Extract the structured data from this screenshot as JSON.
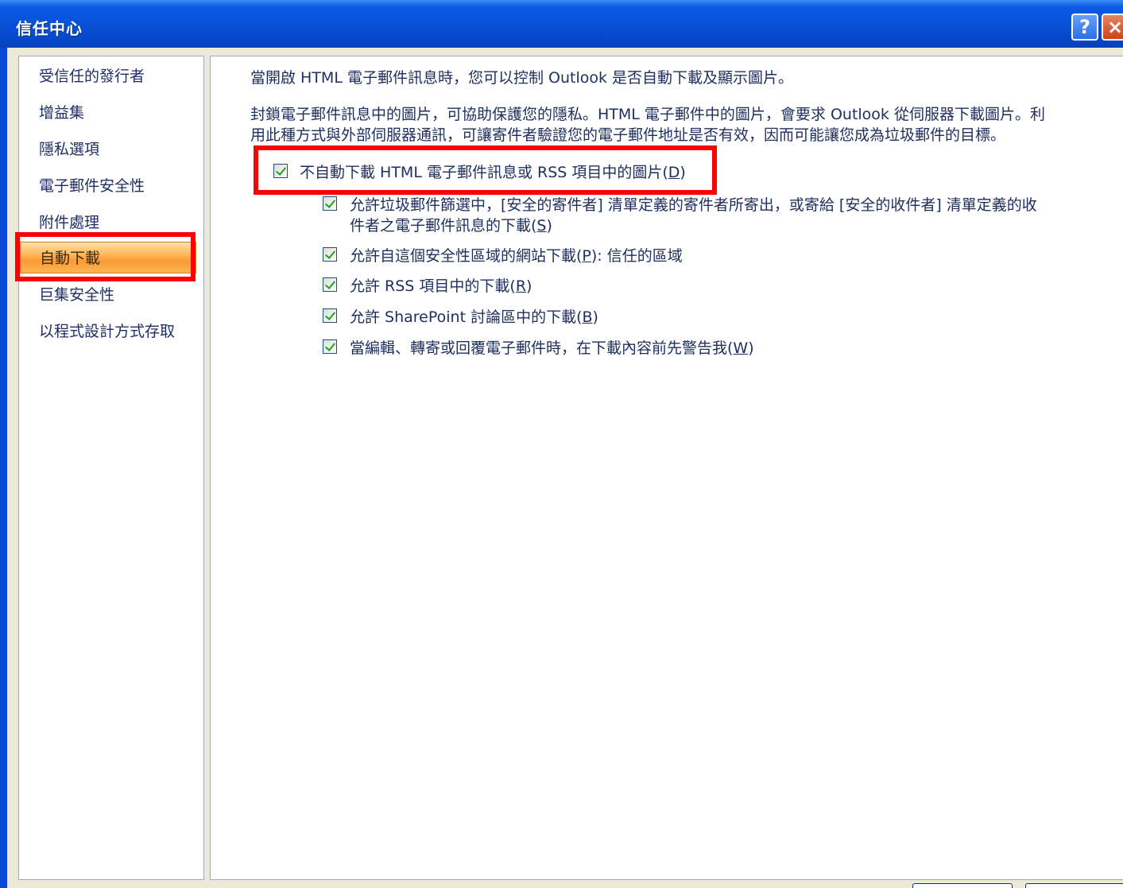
{
  "window": {
    "title": "信任中心",
    "help_glyph": "?",
    "close_glyph": "×"
  },
  "nav": {
    "items": [
      {
        "label": "受信任的發行者"
      },
      {
        "label": "增益集"
      },
      {
        "label": "隱私選項"
      },
      {
        "label": "電子郵件安全性"
      },
      {
        "label": "附件處理"
      },
      {
        "label": "自動下載",
        "selected": true
      },
      {
        "label": "巨集安全性"
      },
      {
        "label": "以程式設計方式存取"
      }
    ]
  },
  "main": {
    "intro": "當開啟 HTML 電子郵件訊息時，您可以控制 Outlook 是否自動下載及顯示圖片。",
    "description_line1": "封鎖電子郵件訊息中的圖片，可協助保護您的隱私。HTML 電子郵件中的圖片，會要求 Outlook 從伺服器下載圖片。利",
    "description_line2": "用此種方式與外部伺服器通訊，可讓寄件者驗證您的電子郵件地址是否有效，因而可能讓您成為垃圾郵件的目標。",
    "options": {
      "no_auto_download": {
        "text": "不自動下載 HTML 電子郵件訊息或 RSS 項目中的圖片(",
        "key": "D",
        "tail": ")",
        "checked": true
      },
      "allow_junk_filter_line1": "允許垃圾郵件篩選中，[安全的寄件者] 清單定義的寄件者所寄出，或寄給 [安全的收件者] 清單定義的收",
      "allow_junk_filter_line2": {
        "text": "件者之電子郵件訊息的下載(",
        "key": "S",
        "tail": ")"
      },
      "allow_zone": {
        "text": "允許自這個安全性區域的網站下載(",
        "key": "P",
        "tail": "): 信任的區域"
      },
      "allow_rss": {
        "text": "允許 RSS 項目中的下載(",
        "key": "R",
        "tail": ")"
      },
      "allow_sharepoint": {
        "text": "允許 SharePoint 討論區中的下載(",
        "key": "B",
        "tail": ")"
      },
      "warn_before": {
        "text": "當編輯、轉寄或回覆電子郵件時，在下載內容前先警告我(",
        "key": "W",
        "tail": ")"
      }
    }
  },
  "colors": {
    "titlebar": "#0a49d6",
    "highlight": "#ff0000",
    "selected_nav": "#fb9a36",
    "check": "#21a121"
  }
}
